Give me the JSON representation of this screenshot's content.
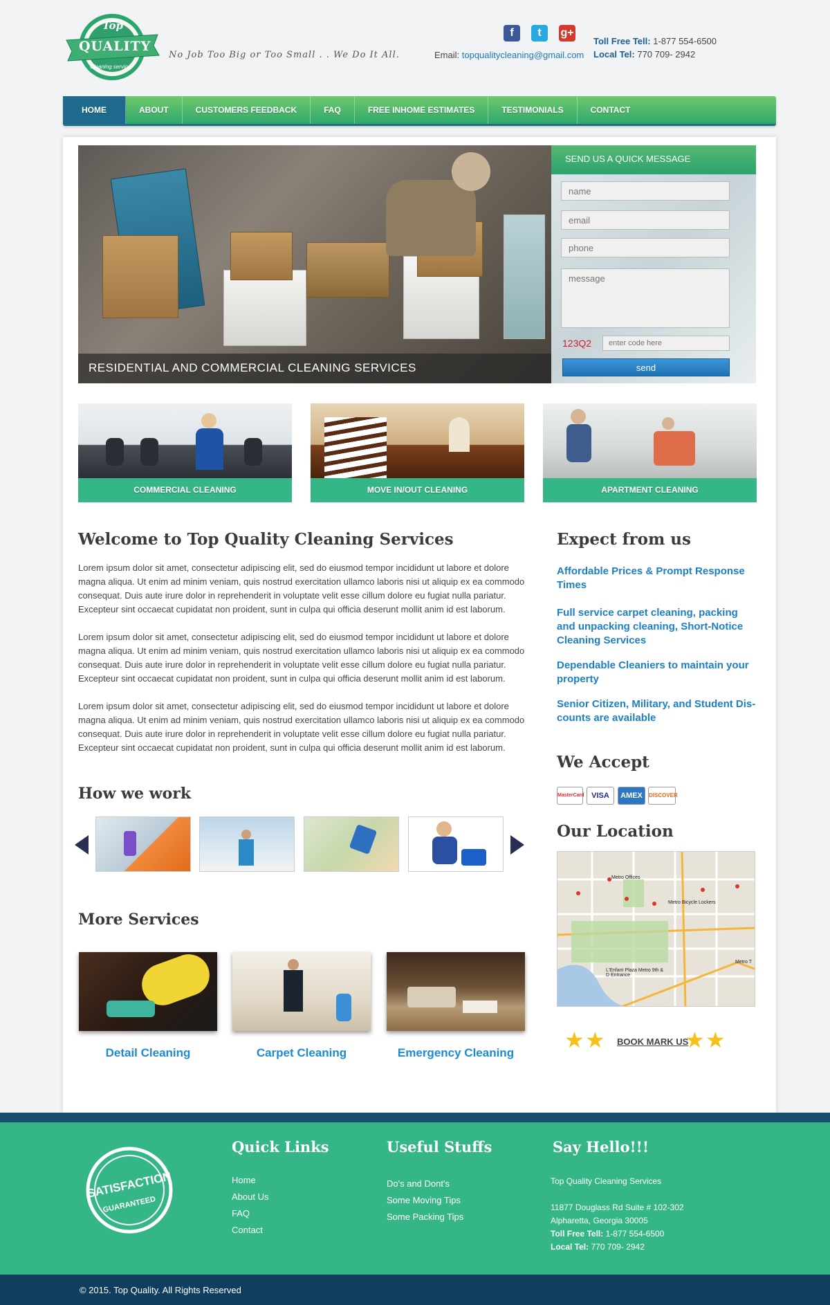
{
  "brand": {
    "logo_top": "Top",
    "logo_main": "QUALITY",
    "logo_sub": "Cleaning service",
    "tagline": "No Job Too Big or Too Small . . We Do It All."
  },
  "contact": {
    "email_label": "Email:",
    "email": "topqualitycleaning@gmail.com",
    "tollfree_label": "Toll Free Tell:",
    "tollfree": "1-877 554-6500",
    "local_label": "Local Tel:",
    "local": "770 709- 2942"
  },
  "social": [
    {
      "name": "facebook-icon",
      "glyph": "f",
      "color": "#3b5998"
    },
    {
      "name": "twitter-icon",
      "glyph": "t",
      "color": "#2aa9e0"
    },
    {
      "name": "google-plus-icon",
      "glyph": "g+",
      "color": "#d23b2c"
    }
  ],
  "nav": [
    "HOME",
    "ABOUT",
    "CUSTOMERS FEEDBACK",
    "FAQ",
    "FREE INHOME ESTIMATES",
    "TESTIMONIALS",
    "CONTACT"
  ],
  "slider": {
    "caption": "RESIDENTIAL AND COMMERCIAL CLEANING SERVICES"
  },
  "quick_form": {
    "title": "SEND US A QUICK MESSAGE",
    "name_placeholder": "name",
    "email_placeholder": "email",
    "phone_placeholder": "phone",
    "message_placeholder": "message",
    "captcha_code": "123Q2",
    "captcha_placeholder": "enter code here",
    "send_label": "send"
  },
  "tiles": [
    "COMMERCIAL CLEANING",
    "MOVE IN/OUT CLEANING",
    "APARTMENT CLEANING"
  ],
  "welcome": {
    "title": "Welcome to Top Quality Cleaning Services",
    "paragraphs": [
      "Lorem ipsum dolor sit amet, consectetur adipiscing elit, sed do eiusmod tempor incididunt ut labore et dolore magna aliqua. Ut enim ad minim veniam, quis nostrud exercitation ullamco laboris nisi ut aliquip ex ea commodo consequat. Duis aute irure dolor in reprehenderit in voluptate velit esse cillum dolore eu fugiat nulla pariatur. Excepteur sint occaecat cupidatat non proident, sunt in culpa qui officia deserunt mollit anim id est laborum.",
      "Lorem ipsum dolor sit amet, consectetur adipiscing elit, sed do eiusmod tempor incididunt ut labore et dolore magna aliqua. Ut enim ad minim veniam, quis nostrud exercitation ullamco laboris nisi ut aliquip ex ea commodo consequat. Duis aute irure dolor in reprehenderit in voluptate velit esse cillum dolore eu fugiat nulla pariatur. Excepteur sint occaecat cupidatat non proident, sunt in culpa qui officia deserunt mollit anim id est laborum.",
      "Lorem ipsum dolor sit amet, consectetur adipiscing elit, sed do eiusmod tempor incididunt ut labore et dolore magna aliqua. Ut enim ad minim veniam, quis nostrud exercitation ullamco laboris nisi ut aliquip ex ea commodo consequat. Duis aute irure dolor in reprehenderit in voluptate velit esse cillum dolore eu fugiat nulla pariatur. Excepteur sint occaecat cupidatat non proident, sunt in culpa qui officia deserunt mollit anim id est laborum."
    ]
  },
  "expect": {
    "title": "Expect from us",
    "items": [
      "Affordable Prices & Prompt Response Times",
      "Full service carpet cleaning, packing and unpacking cleaning, Short-Notice Cleaning Services",
      "Dependable Cleaniers to maintain your property",
      "Senior Citizen, Military, and Student Dis-counts are available"
    ]
  },
  "accept": {
    "title": "We Accept",
    "cards": [
      "MasterCard",
      "VISA",
      "AMEX",
      "DISCOVER"
    ]
  },
  "location": {
    "title": "Our Location",
    "map_labels": [
      "Metro Offices",
      "Metro Bicycle Lockers",
      "L'Enfant Plaza Metro 9th & D Entrance",
      "Metro T"
    ]
  },
  "bookmark": {
    "label": "BOOK MARK US"
  },
  "how_we_work": {
    "title": "How we work"
  },
  "more_services": {
    "title": "More Services",
    "items": [
      "Detail Cleaning",
      "Carpet Cleaning",
      "Emergency Cleaning"
    ]
  },
  "footer": {
    "seal_top": "SATISFACTION",
    "seal_bottom": "GUARANTEED",
    "quick_links_title": "Quick Links",
    "quick_links": [
      "Home",
      "About Us",
      "FAQ",
      "Contact"
    ],
    "useful_title": "Useful Stuffs",
    "useful": [
      "Do's and Dont's",
      "Some Moving Tips",
      "Some Packing Tips"
    ],
    "hello_title": "Say Hello!!!",
    "company": "Top Quality Cleaning Services",
    "address1": "11877 Douglass Rd Suite # 102-302",
    "address2": "Alpharetta, Georgia 30005",
    "tollfree_label": "Toll Free Tell:",
    "tollfree": "1-877 554-6500",
    "local_label": "Local Tel:",
    "local": "770 709- 2942",
    "copyright": "© 2015. Top Quality. All Rights Reserved"
  },
  "colors": {
    "green": "#35b686",
    "navy": "#0f3e5e",
    "link_blue": "#1d7fc4"
  }
}
